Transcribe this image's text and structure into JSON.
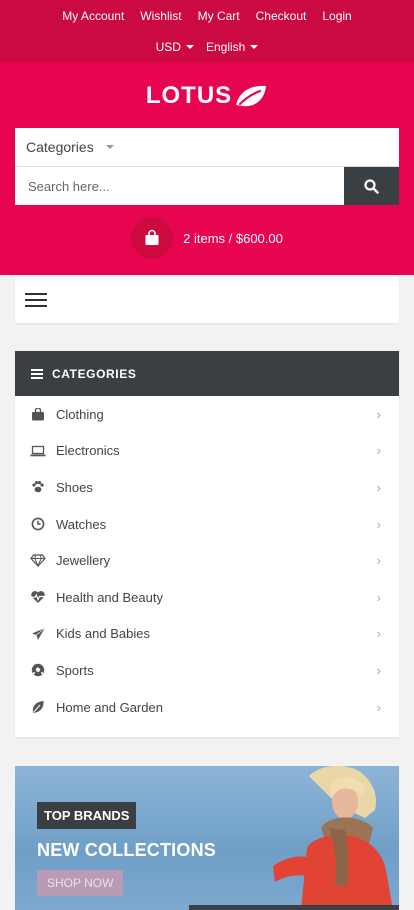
{
  "topbar": {
    "links": [
      "My Account",
      "Wishlist",
      "My Cart",
      "Checkout",
      "Login"
    ],
    "currency": "USD",
    "language": "English"
  },
  "logo": {
    "text": "LOTUS"
  },
  "search": {
    "categories_label": "Categories",
    "placeholder": "Search here..."
  },
  "cart": {
    "summary": "2 items / $600.00"
  },
  "categories": {
    "heading": "CATEGORIES",
    "items": [
      {
        "label": "Clothing",
        "icon": "bag-icon"
      },
      {
        "label": "Electronics",
        "icon": "laptop-icon"
      },
      {
        "label": "Shoes",
        "icon": "paw-icon"
      },
      {
        "label": "Watches",
        "icon": "clock-icon"
      },
      {
        "label": "Jewellery",
        "icon": "diamond-icon"
      },
      {
        "label": "Health and Beauty",
        "icon": "heartbeat-icon"
      },
      {
        "label": "Kids and Babies",
        "icon": "paper-plane-icon"
      },
      {
        "label": "Sports",
        "icon": "soccer-ball-icon"
      },
      {
        "label": "Home and Garden",
        "icon": "leaf-icon"
      }
    ]
  },
  "banner": {
    "tag": "TOP BRANDS",
    "headline": "NEW COLLECTIONS",
    "button": "SHOP NOW"
  },
  "colors": {
    "brand": "#e8054f",
    "brand_dark": "#cc0a42",
    "dark": "#3a3f44"
  }
}
